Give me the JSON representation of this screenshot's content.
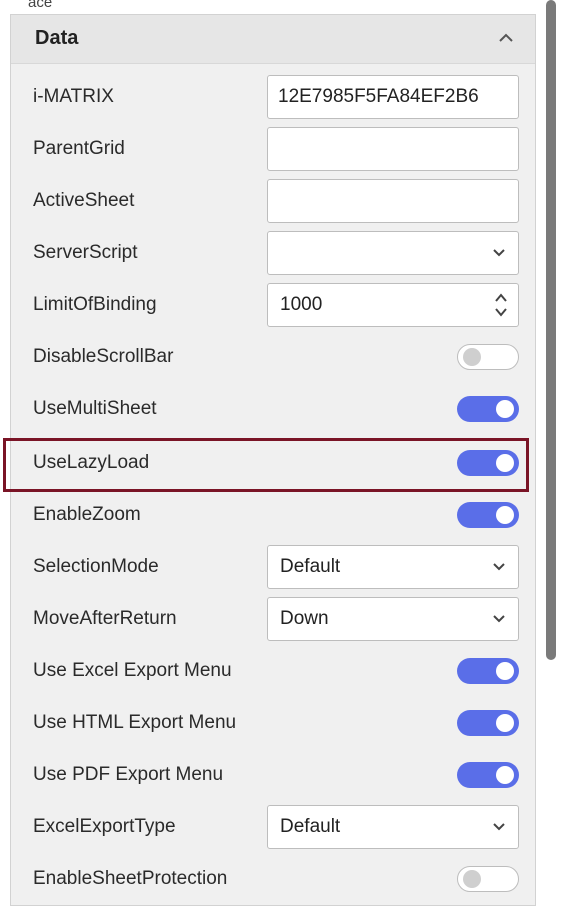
{
  "top_fragment": "ace",
  "section": {
    "title": "Data"
  },
  "properties": {
    "imatrix": {
      "label": "i-MATRIX",
      "value": "12E7985F5FA84EF2B6"
    },
    "parentgrid": {
      "label": "ParentGrid",
      "value": ""
    },
    "activesheet": {
      "label": "ActiveSheet",
      "value": ""
    },
    "serverscript": {
      "label": "ServerScript",
      "value": ""
    },
    "limitofbinding": {
      "label": "LimitOfBinding",
      "value": "1000"
    },
    "disablescrollbar": {
      "label": "DisableScrollBar",
      "state": "off"
    },
    "usemultisheet": {
      "label": "UseMultiSheet",
      "state": "on"
    },
    "uselazyload": {
      "label": "UseLazyLoad",
      "state": "on"
    },
    "enablezoom": {
      "label": "EnableZoom",
      "state": "on"
    },
    "selectionmode": {
      "label": "SelectionMode",
      "value": "Default"
    },
    "moveafterreturn": {
      "label": "MoveAfterReturn",
      "value": "Down"
    },
    "useexcelexport": {
      "label": "Use Excel Export Menu",
      "state": "on"
    },
    "usehtmlexport": {
      "label": "Use HTML Export Menu",
      "state": "on"
    },
    "usepdfexport": {
      "label": "Use PDF Export Menu",
      "state": "on"
    },
    "excelexporttype": {
      "label": "ExcelExportType",
      "value": "Default"
    },
    "enablesheetprotection": {
      "label": "EnableSheetProtection",
      "state": "off"
    }
  },
  "colors": {
    "toggle_on": "#5a6ee8",
    "highlight": "#7a1426",
    "panel": "#f0f0f0"
  },
  "icons": {
    "collapse": "chevron-up-icon",
    "dropdown": "chevron-down-icon",
    "spinner": "spinner-arrows-icon"
  }
}
